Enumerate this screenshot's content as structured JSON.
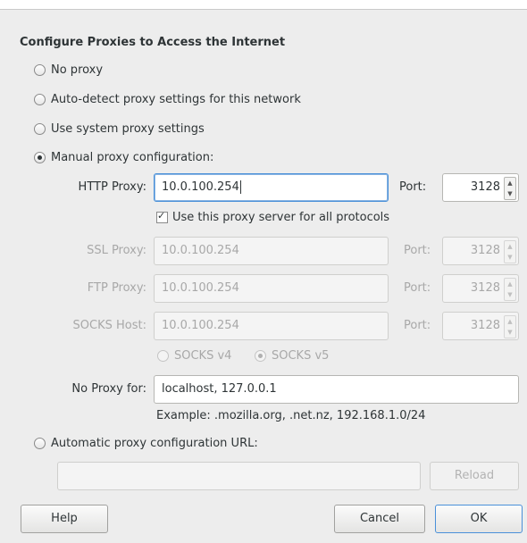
{
  "dialog": {
    "heading": "Configure Proxies to Access the Internet"
  },
  "options": {
    "no_proxy": "No proxy",
    "auto_detect": "Auto-detect proxy settings for this network",
    "system": "Use system proxy settings",
    "manual": "Manual proxy configuration:",
    "auto_url": "Automatic proxy configuration URL:"
  },
  "manual": {
    "http_label": "HTTP Proxy:",
    "http_value": "10.0.100.254",
    "port_label": "Port:",
    "http_port": "3128",
    "same_proxy_label": "Use this proxy server for all protocols",
    "same_proxy_checked": true,
    "ssl_label": "SSL Proxy:",
    "ssl_value": "10.0.100.254",
    "ssl_port": "3128",
    "ftp_label": "FTP Proxy:",
    "ftp_value": "10.0.100.254",
    "ftp_port": "3128",
    "socks_label": "SOCKS Host:",
    "socks_value": "10.0.100.254",
    "socks_port": "3128",
    "socks_v4": "SOCKS v4",
    "socks_v5": "SOCKS v5",
    "no_proxy_label": "No Proxy for:",
    "no_proxy_value": "localhost, 127.0.0.1",
    "example": "Example: .mozilla.org, .net.nz, 192.168.1.0/24"
  },
  "auto_url": {
    "value": "",
    "reload_label": "Reload"
  },
  "buttons": {
    "help": "Help",
    "cancel": "Cancel",
    "ok": "OK"
  },
  "selected_option": "manual",
  "colors": {
    "focus": "#4a90d9",
    "background": "#ededed",
    "disabled_text": "#a8a8a8"
  }
}
